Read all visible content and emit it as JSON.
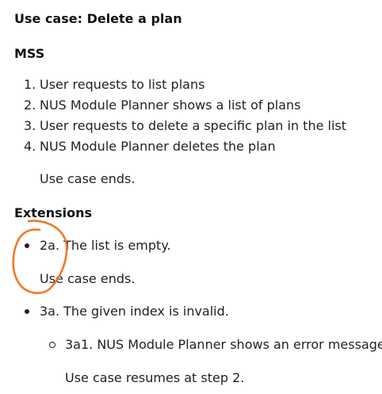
{
  "use_case_title": "Use case: Delete a plan",
  "mss": {
    "heading": "MSS",
    "steps": [
      {
        "number": "1.",
        "text": "User requests to list plans"
      },
      {
        "number": "2.",
        "text": "NUS Module Planner shows a list of plans"
      },
      {
        "number": "3.",
        "text": "User requests to delete a specific plan in the list"
      },
      {
        "number": "4.",
        "text": "NUS Module Planner deletes the plan"
      }
    ],
    "end_note": "Use case ends."
  },
  "extensions": {
    "heading": "Extensions",
    "items": [
      {
        "text": "2a. The list is empty.",
        "note": "Use case ends."
      },
      {
        "text": "3a. The given index is invalid.",
        "sub": {
          "text": "3a1. NUS Module Planner shows an error message.",
          "note": "Use case resumes at step 2."
        }
      }
    ]
  },
  "annotation_color": "#f07a28"
}
